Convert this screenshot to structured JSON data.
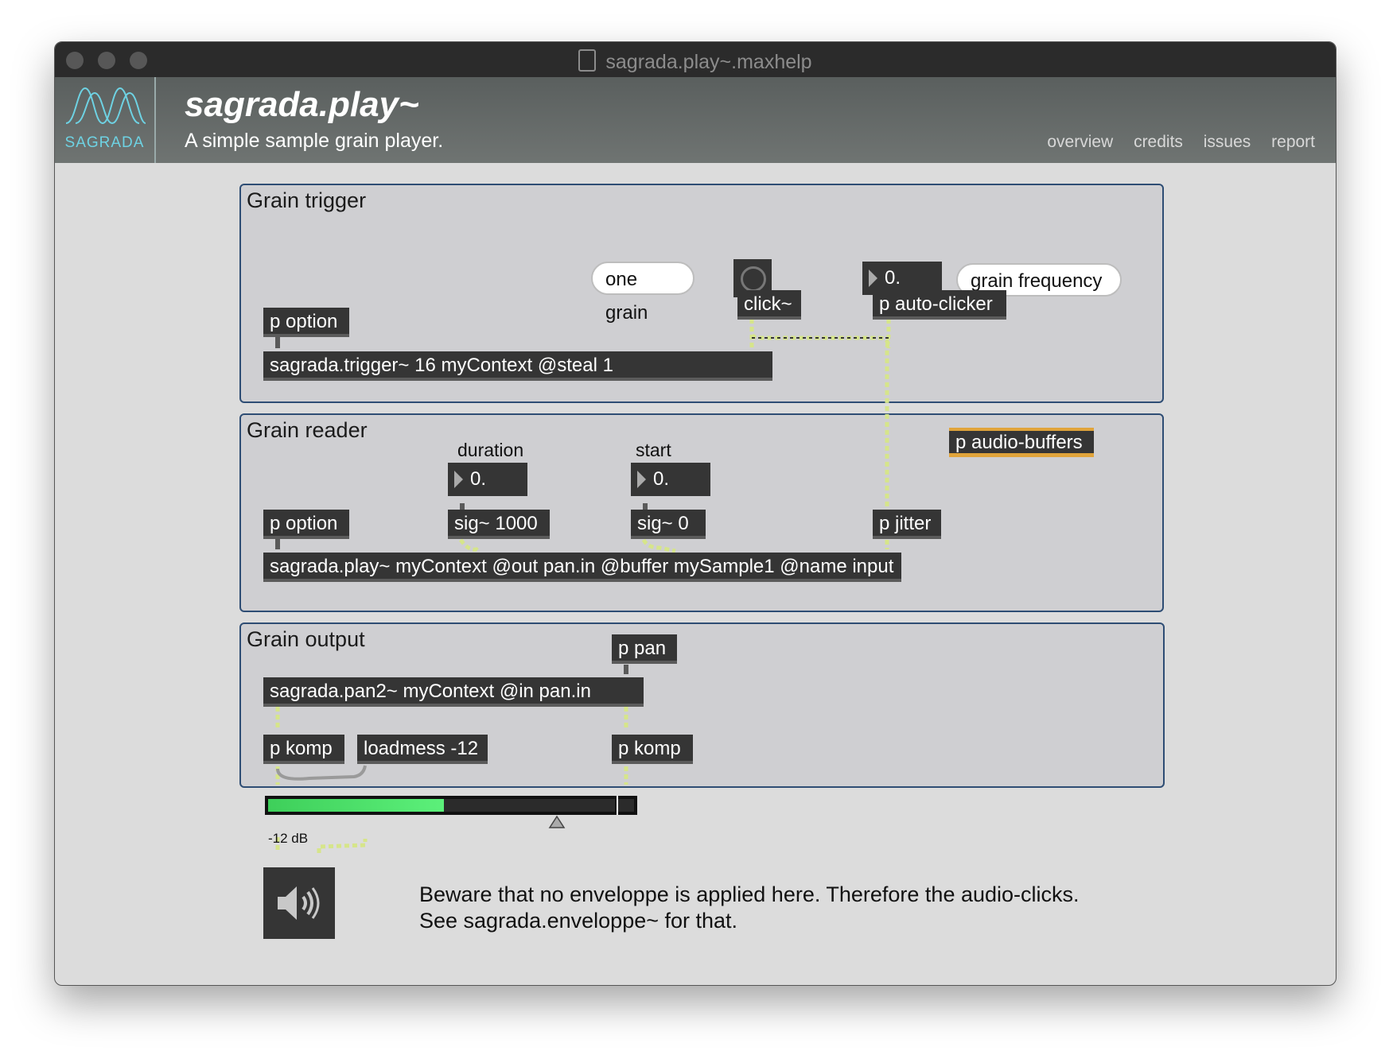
{
  "window": {
    "title": "sagrada.play~.maxhelp"
  },
  "header": {
    "logo_text": "SAGRADA",
    "title": "sagrada.play~",
    "subtitle": "A simple sample grain player.",
    "nav": [
      "overview",
      "credits",
      "issues",
      "report"
    ]
  },
  "panels": {
    "trigger": {
      "title": "Grain trigger",
      "one_grain": "one grain",
      "grain_frequency": "grain frequency",
      "number_value": "0.",
      "click_obj": "click~",
      "autoclicker_obj": "p auto-clicker",
      "option_obj": "p option",
      "trigger_obj": "sagrada.trigger~ 16 myContext @steal 1"
    },
    "reader": {
      "title": "Grain reader",
      "duration_label": "duration",
      "start_label": "start",
      "duration_value": "0.",
      "start_value": "0.",
      "sig_duration": "sig~ 1000",
      "sig_start": "sig~ 0",
      "option_obj": "p option",
      "jitter_obj": "p jitter",
      "audio_buffers_obj": "p audio-buffers",
      "play_obj": "sagrada.play~ myContext @out pan.in @buffer mySample1 @name input"
    },
    "output": {
      "title": "Grain output",
      "pan_obj": "p pan",
      "pan2_obj": "sagrada.pan2~ myContext @in pan.in",
      "komp_left": "p komp",
      "loadmess": "loadmess -12",
      "komp_right": "p komp"
    }
  },
  "gain": {
    "db_label": "-12 dB",
    "level": 0.48
  },
  "note": {
    "line1": "Beware that no enveloppe is applied here. Therefore the audio-clicks.",
    "line2": "See sagrada.enveloppe~ for that."
  },
  "colors": {
    "panel_border": "#2e4d74",
    "logo": "#6ed2e3",
    "meter": "#4ce06a",
    "highlight": "#e0a43b"
  }
}
